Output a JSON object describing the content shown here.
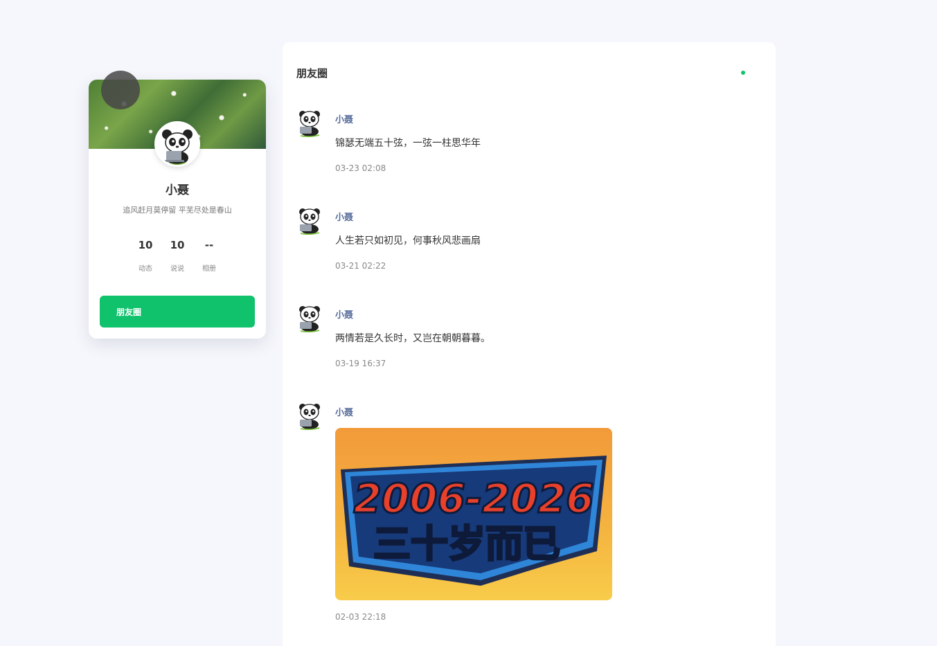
{
  "profile": {
    "name": "小聂",
    "bio": "追风赶月莫停留 平芜尽处是春山",
    "stats": [
      {
        "value": "10",
        "label": "动态"
      },
      {
        "value": "10",
        "label": "说说"
      },
      {
        "value": "--",
        "label": "相册"
      }
    ],
    "nav_button": "朋友圈"
  },
  "feed": {
    "title": "朋友圈",
    "status_color": "#11c26d",
    "posts": [
      {
        "author": "小聂",
        "text": "锦瑟无端五十弦，一弦一柱思华年",
        "time": "03-23 02:08"
      },
      {
        "author": "小聂",
        "text": "人生若只如初见，何事秋风悲画扇",
        "time": "03-21 02:22"
      },
      {
        "author": "小聂",
        "text": "两情若是久长时，又岂在朝朝暮暮。",
        "time": "03-19 16:37"
      },
      {
        "author": "小聂",
        "image": {
          "line1": "2006-2026",
          "line2": "三十岁而已"
        },
        "time": "02-03 22:18"
      }
    ]
  },
  "colors": {
    "accent": "#11c26d",
    "author": "#556b9a",
    "background": "#f6f7fc"
  }
}
